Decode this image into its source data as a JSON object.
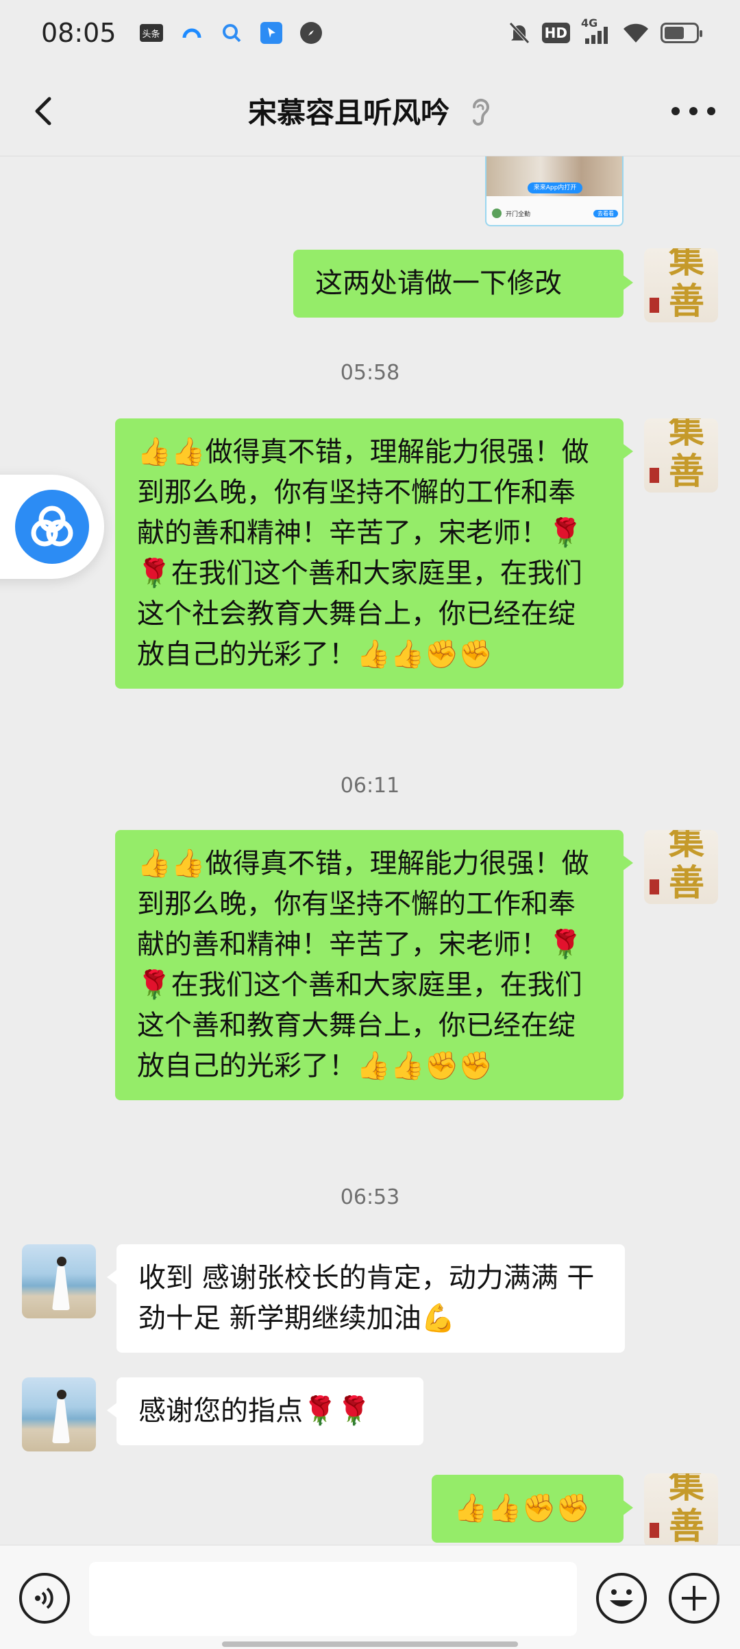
{
  "status": {
    "time": "08:05",
    "app_label": "头条",
    "network": "4G",
    "hd": "HD"
  },
  "header": {
    "title": "宋慕容且听风吟"
  },
  "messages": [
    {
      "from": "me",
      "text": "这两处请做一下修改"
    },
    {
      "type": "time",
      "text": "05:58"
    },
    {
      "from": "me",
      "text": "👍👍做得真不错，理解能力很强！做到那么晚，你有坚持不懈的工作和奉献的善和精神！辛苦了，宋老师！🌹🌹在我们这个善和大家庭里，在我们这个社会教育大舞台上，你已经在绽放自己的光彩了！👍👍✊✊"
    },
    {
      "type": "time",
      "text": "06:11"
    },
    {
      "from": "me",
      "text": "👍👍做得真不错，理解能力很强！做到那么晚，你有坚持不懈的工作和奉献的善和精神！辛苦了，宋老师！🌹🌹在我们这个善和大家庭里，在我们这个善和教育大舞台上，你已经在绽放自己的光彩了！👍👍✊✊"
    },
    {
      "type": "time",
      "text": "06:53"
    },
    {
      "from": "her",
      "text": "收到 感谢张校长的肯定，动力满满 干劲十足 新学期继续加油💪"
    },
    {
      "from": "her",
      "text": "感谢您的指点🌹🌹"
    },
    {
      "from": "me",
      "text": "👍👍✊✊"
    }
  ],
  "thumb": {
    "pill": "来来App内打开",
    "row_text": "开门全勤",
    "row_btn": "去看看"
  },
  "avatar_me": {
    "line1": "集",
    "line2": "善"
  },
  "input": {
    "placeholder": ""
  }
}
